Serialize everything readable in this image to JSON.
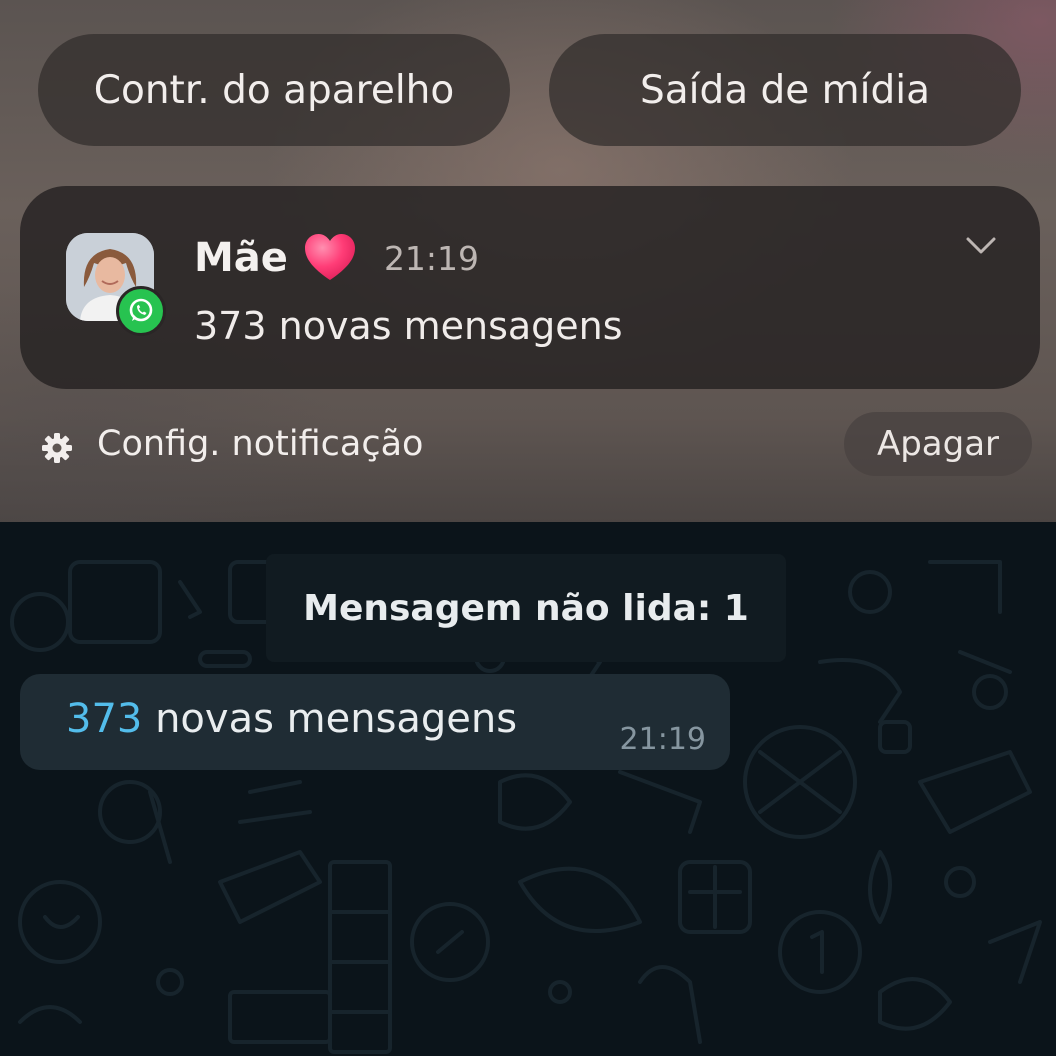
{
  "quick_controls": {
    "device_control_label": "Contr. do aparelho",
    "media_output_label": "Saída de mídia"
  },
  "notification": {
    "app_icon": "whatsapp-icon",
    "sender": "Mãe",
    "emoji": "heart",
    "time": "21:19",
    "body": "373 novas mensagens"
  },
  "notification_footer": {
    "settings_label": "Config. notificação",
    "clear_label": "Apagar"
  },
  "chat": {
    "unread_banner": "Mensagem não lida: 1",
    "message": {
      "count": "373",
      "text": " novas mensagens",
      "time": "21:19"
    }
  },
  "colors": {
    "chat_background": "#0b141a",
    "bubble": "#1f2c34",
    "link_blue": "#53bdeb",
    "whatsapp_green": "#27c350"
  }
}
